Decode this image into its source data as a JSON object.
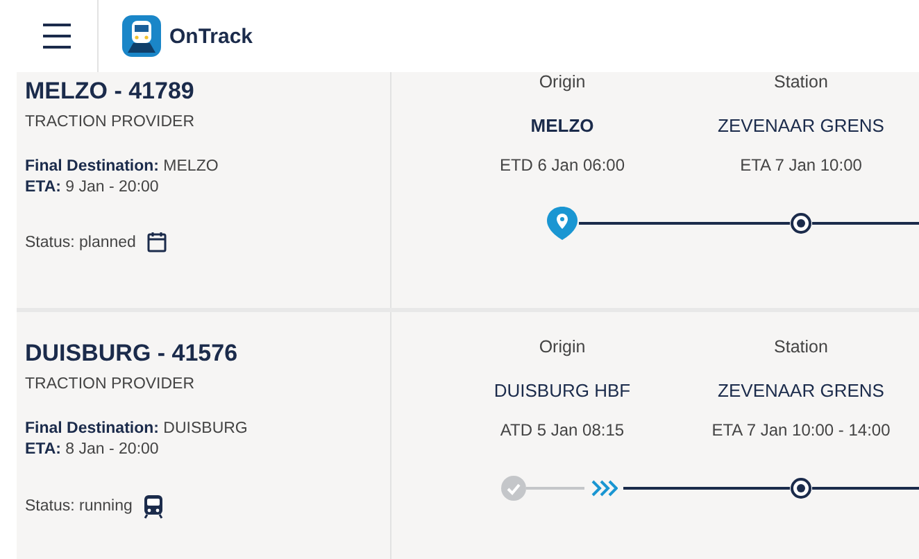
{
  "app": {
    "name": "OnTrack"
  },
  "trains": [
    {
      "title": "MELZO - 41789",
      "provider": "TRACTION PROVIDER",
      "final_destination": "**Final Destination:** MELZO",
      "eta": "**ETA:** 9 Jan - 20:00",
      "status": {
        "text": "Status: planned",
        "kind": "planned"
      },
      "stops": [
        {
          "label": "Origin",
          "place": "MELZO",
          "time": "ETD 6 Jan 06:00",
          "kind": "current"
        },
        {
          "label": "Station",
          "place": "ZEVENAAR GRENS",
          "time": "ETA 7 Jan 10:00",
          "kind": "upcoming"
        }
      ]
    },
    {
      "title": "DUISBURG - 41576",
      "provider": "TRACTION PROVIDER",
      "final_destination": "**Final Destination:** DUISBURG",
      "eta": "**ETA:** 8 Jan - 20:00",
      "status": {
        "text": "Status: running",
        "kind": "running"
      },
      "stops": [
        {
          "label": "Origin",
          "place": "DUISBURG HBF",
          "time": "ATD 5 Jan 08:15",
          "kind": "passed"
        },
        {
          "label": "Station",
          "place": "ZEVENAAR GRENS",
          "time": "ETA 7 Jan 10:00 - 14:00",
          "kind": "upcoming"
        }
      ]
    }
  ]
}
